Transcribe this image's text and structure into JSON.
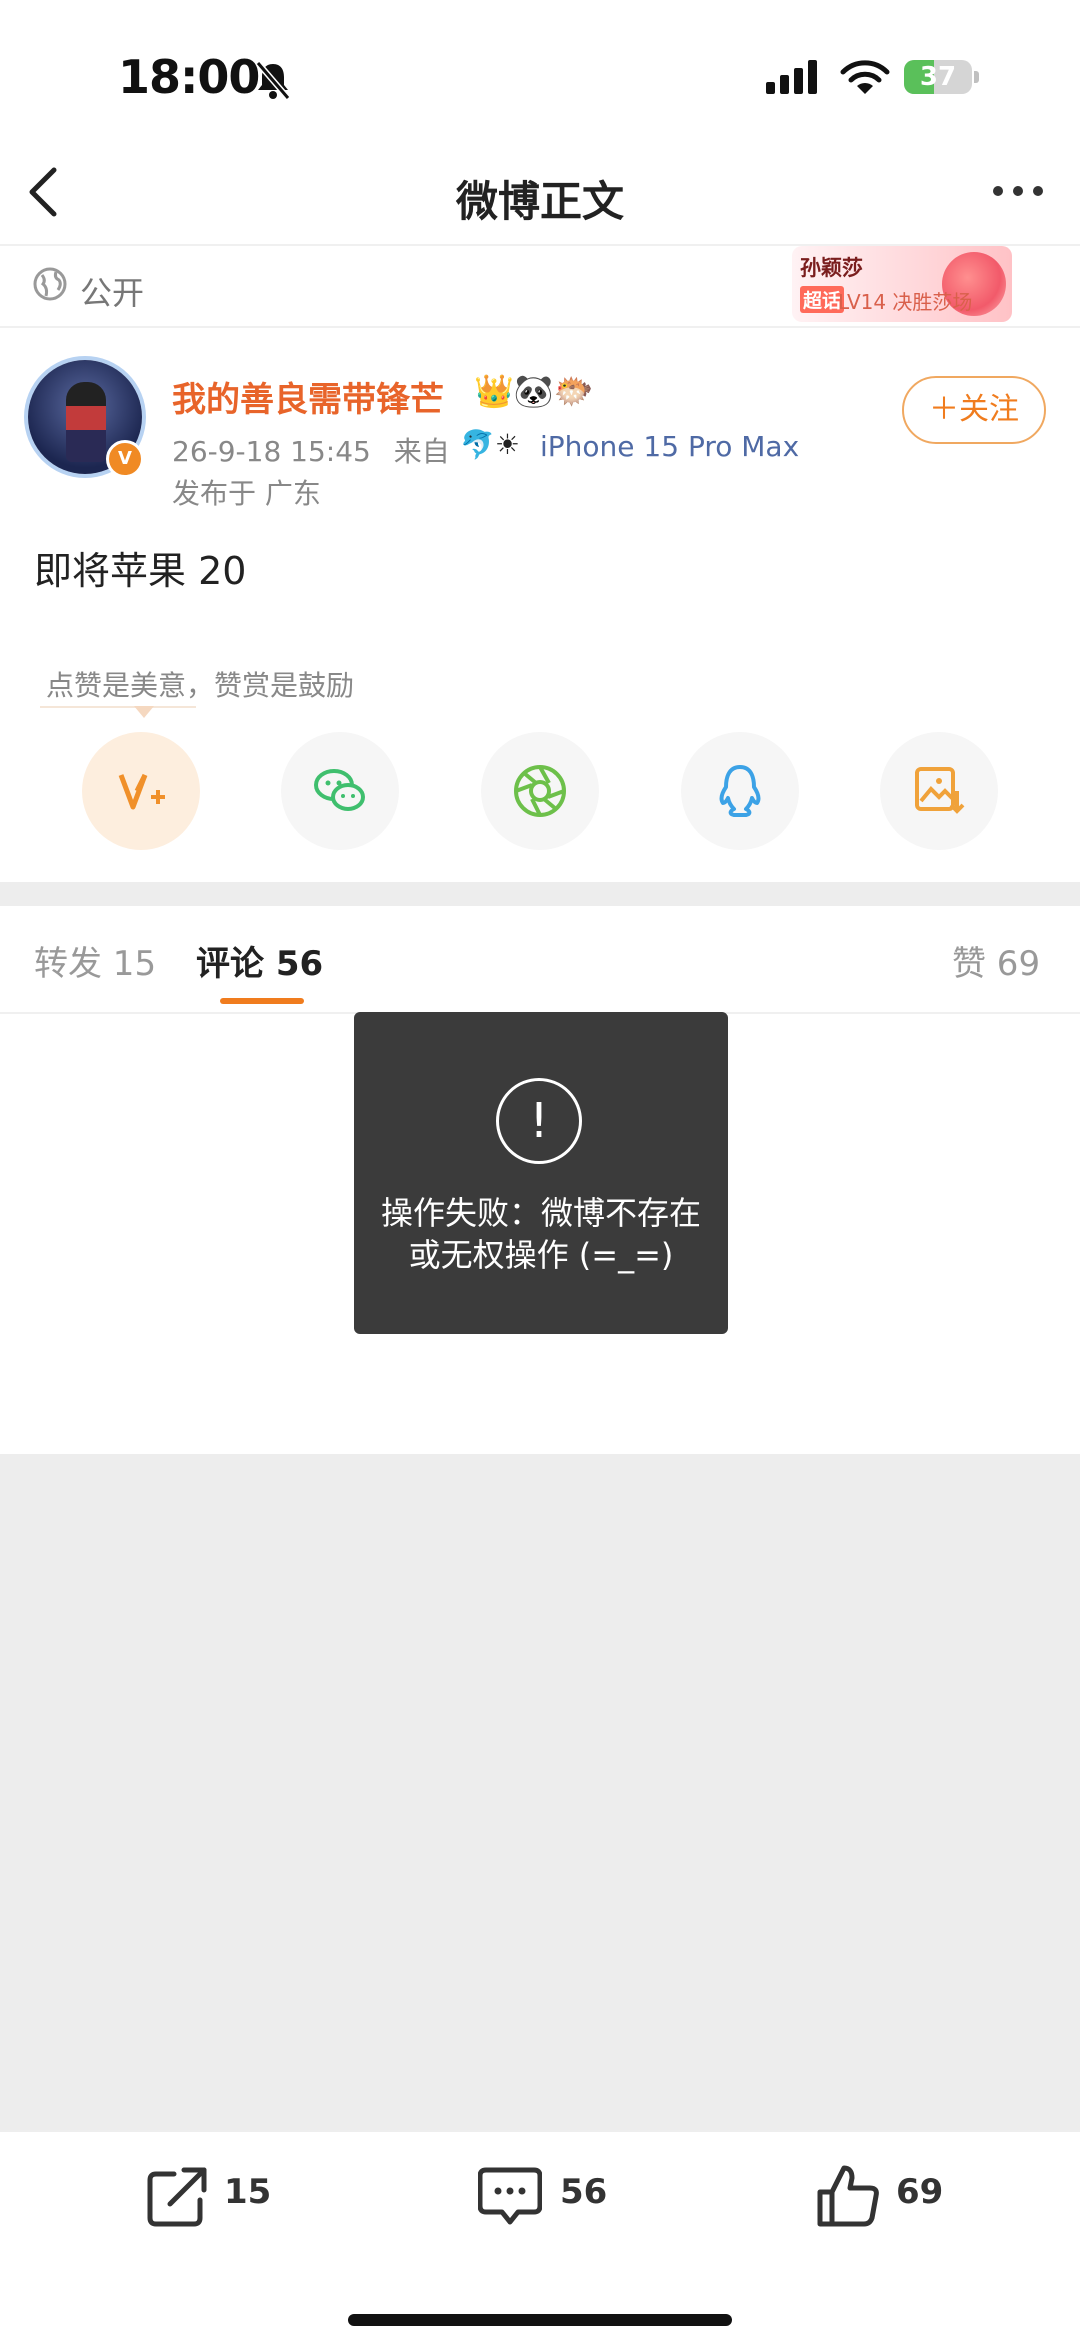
{
  "status_bar": {
    "time": "18:00",
    "battery": "37"
  },
  "nav": {
    "title": "微博正文"
  },
  "visibility": {
    "label": "公开"
  },
  "promo": {
    "name": "孙颖莎",
    "tag": "超话",
    "text": "LV14 决胜莎场"
  },
  "post": {
    "username": "我的善良需带锋芒",
    "username_emojis": "👑🐼🐡",
    "time": "26-9-18 15:45",
    "source_prefix": "来自",
    "device_emojis": "🐬☀",
    "device": "iPhone 15 Pro Max",
    "location": "发布于 广东",
    "follow_label": "＋关注",
    "content": "即将苹果 20"
  },
  "reward_hint": "点赞是美意，赞赏是鼓励",
  "share_icons": [
    "reward-icon",
    "wechat-icon",
    "moments-icon",
    "qq-icon",
    "save-image-icon"
  ],
  "tabs": {
    "repost": "转发 15",
    "comment": "评论 56",
    "like": "赞 69"
  },
  "toast": {
    "icon": "!",
    "message": "操作失败：微博不存在或无权操作 (=_=)"
  },
  "actions": {
    "repost_count": "15",
    "comment_count": "56",
    "like_count": "69"
  },
  "colors": {
    "accent": "#f07c1e",
    "username": "#e8642a",
    "device": "#4f6aa5",
    "toast_bg": "#3b3b3b"
  }
}
